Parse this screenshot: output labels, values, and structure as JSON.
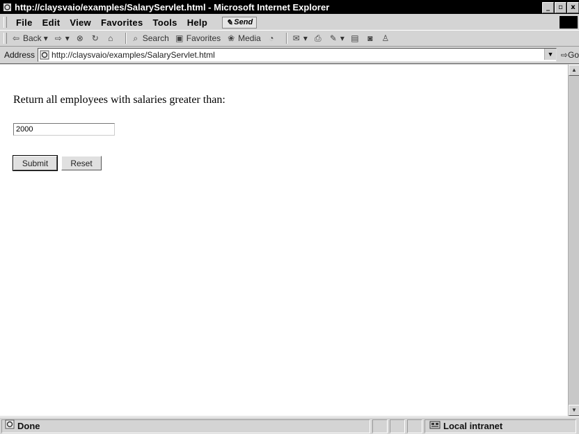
{
  "window": {
    "title": "http://claysvaio/examples/SalaryServlet.html - Microsoft Internet Explorer",
    "controls": [
      "_",
      "Ή",
      "x"
    ]
  },
  "menu": {
    "items": [
      "File",
      "Edit",
      "View",
      "Favorites",
      "Tools",
      "Help"
    ],
    "send_label": "Send"
  },
  "toolbar": {
    "back_label": "Back",
    "search_label": "Search",
    "favorites_label": "Favorites",
    "media_label": "Media"
  },
  "address": {
    "label": "Address",
    "url": "http://claysvaio/examples/SalaryServlet.html",
    "go_label": "Go"
  },
  "form": {
    "prompt": "Return all employees with salaries greater than:",
    "salary_value": "2000",
    "submit_label": "Submit",
    "reset_label": "Reset"
  },
  "status": {
    "text": "Done",
    "zone": "Local intranet"
  }
}
